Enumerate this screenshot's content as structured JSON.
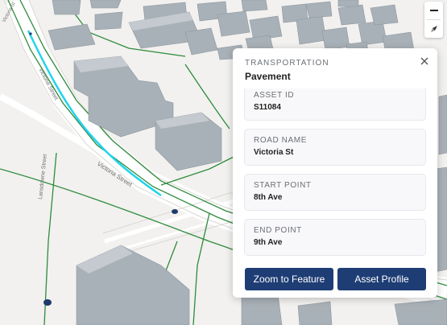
{
  "map": {
    "street_labels": [
      "Victoria Street",
      "Lansdowne Street",
      "Victoria Street",
      "Victoria St"
    ],
    "colors": {
      "highlight": "#22d3ee",
      "rail": "#2e8b3c",
      "building": "#a9b1b8",
      "marker": "#1e3a6b"
    }
  },
  "controls": {
    "zoom_out_icon": "minus-icon",
    "compass_icon": "compass-icon"
  },
  "popup": {
    "category": "TRANSPORTATION",
    "title": "Pavement",
    "fields": [
      {
        "label": "ASSET ID",
        "value": "S11084"
      },
      {
        "label": "ROAD NAME",
        "value": "Victoria St"
      },
      {
        "label": "START POINT",
        "value": "8th Ave"
      },
      {
        "label": "END POINT",
        "value": "9th Ave"
      }
    ],
    "zoom_button": "Zoom to Feature",
    "profile_button": "Asset Profile"
  }
}
